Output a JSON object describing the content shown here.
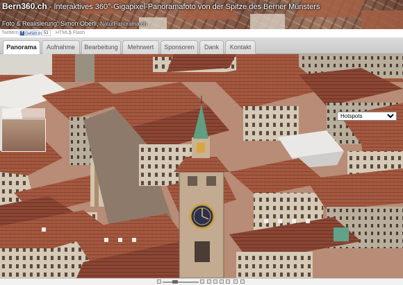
{
  "header": {
    "brand": "Bern360.ch",
    "subtitle": " - Interaktives 360°-Gigapixel-Panoramafoto von der Spitze des Berner Münsters",
    "credit": "Foto & Realisierung: Simon Oberli, ",
    "credit_site": "NaturPanorama.ch"
  },
  "social": {
    "twitter": "Twittern",
    "facebook_like": "Gefällt mir",
    "facebook_count": "51",
    "html5": "HTML5",
    "separator": "|",
    "flash": "Flash"
  },
  "tabs": [
    {
      "label": "Panorama",
      "active": true
    },
    {
      "label": "Aufnahme",
      "active": false
    },
    {
      "label": "Bearbeitung",
      "active": false
    },
    {
      "label": "Mehrwert",
      "active": false
    },
    {
      "label": "Sponsoren",
      "active": false
    },
    {
      "label": "Dank",
      "active": false
    },
    {
      "label": "Kontakt",
      "active": false
    }
  ],
  "viewer": {
    "hotspots_selected": "Hotspots"
  },
  "colors": {
    "roof": "#a7563c",
    "facade": "#d6cab6",
    "tower_copper": "#5f9e80",
    "tab_active": "#ffffff"
  }
}
